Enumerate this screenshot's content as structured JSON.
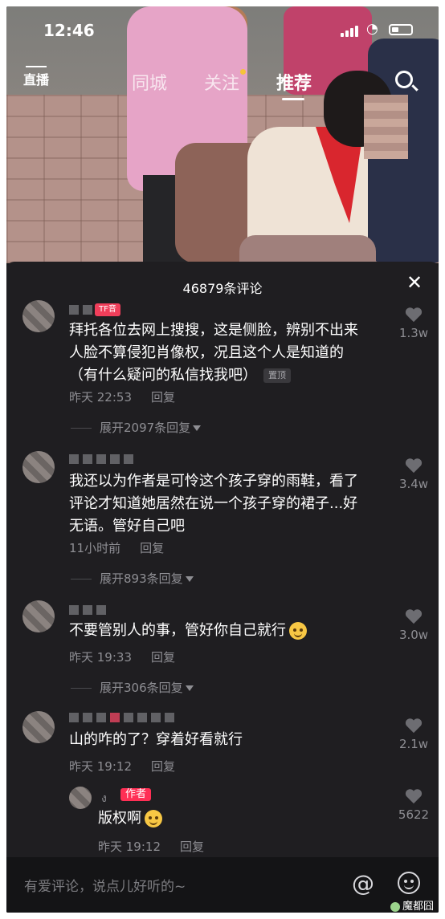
{
  "status_bar": {
    "time": "12:46"
  },
  "nav": {
    "live_label": "直播",
    "tabs": [
      "同城",
      "关注",
      "推荐"
    ],
    "active_tab": "推荐"
  },
  "comments_sheet": {
    "title": "46879条评论",
    "comments": [
      {
        "tag": "TF音",
        "text_lines": [
          "拜托各位去网上搜搜，这是侧脸，辨别不出来",
          "人脸不算侵犯肖像权，况且这个人是知道的",
          "（有什么疑问的私信找我吧）"
        ],
        "pinned_label": "置顶",
        "time": "昨天 22:53",
        "reply_label": "回复",
        "expand_label": "展开2097条回复",
        "likes": "1.3w"
      },
      {
        "text_lines": [
          "我还以为作者是可怜这个孩子穿的雨鞋，看了",
          "评论才知道她居然在说一个孩子穿的裙子...好",
          "无语。管好自己吧"
        ],
        "time": "11小时前",
        "reply_label": "回复",
        "expand_label": "展开893条回复",
        "likes": "3.4w"
      },
      {
        "text_lines": [
          "不要管别人的事，管好你自己就行"
        ],
        "time": "昨天 19:33",
        "reply_label": "回复",
        "expand_label": "展开306条回复",
        "likes": "3.0w"
      },
      {
        "text_lines": [
          "山的咋的了？穿着好看就行"
        ],
        "time": "昨天 19:12",
        "reply_label": "回复",
        "likes": "2.1w"
      }
    ],
    "reply": {
      "user": "ง",
      "tag": "作者",
      "text": "版权啊",
      "time": "昨天 19:12",
      "reply_label": "回复",
      "likes": "5622"
    }
  },
  "input": {
    "placeholder": "有爱评论，说点儿好听的~",
    "at_symbol": "@"
  },
  "watermark": {
    "text": "魔都囧"
  },
  "colors": {
    "sheet_bg": "#1f1e21",
    "tag_red": "#f03e5a",
    "muted": "#8e8e93",
    "nav_dot": "#f6c338"
  },
  "icons": [
    "live-icon",
    "search-icon",
    "close-icon",
    "heart-icon",
    "chevron-down-icon",
    "at-icon",
    "smile-icon",
    "wifi-icon",
    "battery-icon"
  ]
}
